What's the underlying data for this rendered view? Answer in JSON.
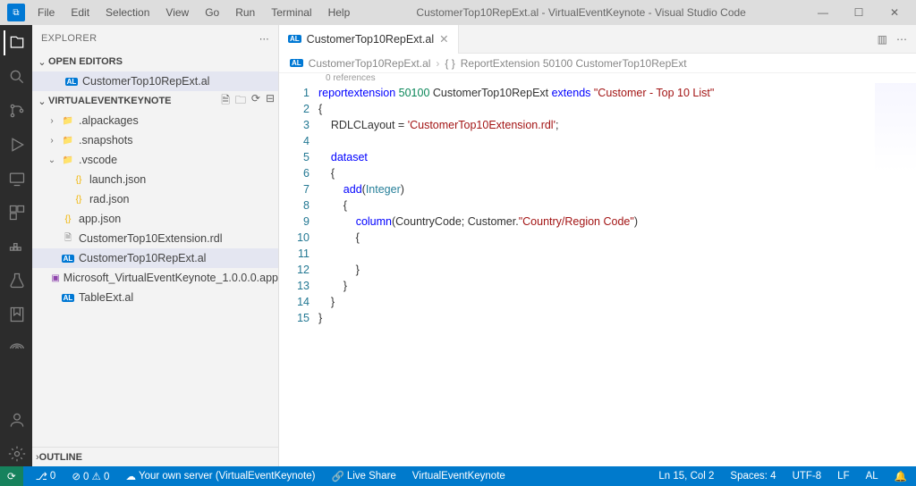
{
  "titlebar": {
    "menu": [
      "File",
      "Edit",
      "Selection",
      "View",
      "Go",
      "Run",
      "Terminal",
      "Help"
    ],
    "title": "CustomerTop10RepExt.al - VirtualEventKeynote - Visual Studio Code",
    "wincontrols": [
      "—",
      "☐",
      "✕"
    ]
  },
  "sidebar": {
    "header": "EXPLORER",
    "openEditors": {
      "label": "OPEN EDITORS",
      "items": [
        {
          "icon": "al",
          "name": "CustomerTop10RepExt.al"
        }
      ]
    },
    "workspace": {
      "label": "VIRTUALEVENTKEYNOTE",
      "tree": [
        {
          "depth": 1,
          "chev": "›",
          "icon": "folder",
          "name": ".alpackages"
        },
        {
          "depth": 1,
          "chev": "›",
          "icon": "folder",
          "name": ".snapshots"
        },
        {
          "depth": 1,
          "chev": "⌄",
          "icon": "folder",
          "name": ".vscode"
        },
        {
          "depth": 2,
          "chev": "",
          "icon": "json",
          "name": "launch.json"
        },
        {
          "depth": 2,
          "chev": "",
          "icon": "json",
          "name": "rad.json"
        },
        {
          "depth": 1,
          "chev": "",
          "icon": "json",
          "name": "app.json"
        },
        {
          "depth": 1,
          "chev": "",
          "icon": "file",
          "name": "CustomerTop10Extension.rdl"
        },
        {
          "depth": 1,
          "chev": "",
          "icon": "al",
          "name": "CustomerTop10RepExt.al",
          "active": true
        },
        {
          "depth": 1,
          "chev": "",
          "icon": "app",
          "name": "Microsoft_VirtualEventKeynote_1.0.0.0.app"
        },
        {
          "depth": 1,
          "chev": "",
          "icon": "al",
          "name": "TableExt.al"
        }
      ]
    },
    "outline": "OUTLINE"
  },
  "editor": {
    "tab": {
      "badge": "AL",
      "name": "CustomerTop10RepExt.al"
    },
    "breadcrumb": {
      "badge": "AL",
      "file": "CustomerTop10RepExt.al",
      "symbolIcon": "{ }",
      "symbol": "ReportExtension 50100 CustomerTop10RepExt"
    },
    "codelens": "0 references",
    "lines": 15,
    "code": [
      [
        [
          "kw",
          "reportextension"
        ],
        [
          "",
          " "
        ],
        [
          "num",
          "50100"
        ],
        [
          "",
          " CustomerTop10RepExt "
        ],
        [
          "kw",
          "extends"
        ],
        [
          "",
          " "
        ],
        [
          "str",
          "\"Customer - Top 10 List\""
        ]
      ],
      [
        [
          "",
          "{"
        ]
      ],
      [
        [
          "",
          "    RDLCLayout = "
        ],
        [
          "str",
          "'CustomerTop10Extension.rdl'"
        ],
        [
          "",
          ";"
        ]
      ],
      [
        [
          "",
          ""
        ]
      ],
      [
        [
          "",
          "    "
        ],
        [
          "kw",
          "dataset"
        ]
      ],
      [
        [
          "",
          "    {"
        ]
      ],
      [
        [
          "",
          "        "
        ],
        [
          "kw",
          "add"
        ],
        [
          "",
          "("
        ],
        [
          "type",
          "Integer"
        ],
        [
          "",
          ")"
        ]
      ],
      [
        [
          "",
          "        {"
        ]
      ],
      [
        [
          "",
          "            "
        ],
        [
          "kw",
          "column"
        ],
        [
          "",
          "(CountryCode; Customer."
        ],
        [
          "str",
          "\"Country/Region Code\""
        ],
        [
          "",
          ")"
        ]
      ],
      [
        [
          "",
          "            {"
        ]
      ],
      [
        [
          "",
          ""
        ]
      ],
      [
        [
          "",
          "            }"
        ]
      ],
      [
        [
          "",
          "        }"
        ]
      ],
      [
        [
          "",
          "    }"
        ]
      ],
      [
        [
          "",
          "}"
        ]
      ]
    ]
  },
  "statusbar": {
    "left": [
      {
        "icon": "⟳",
        "text": ""
      },
      {
        "icon": "⎇",
        "text": "0"
      },
      {
        "icon": "⊘",
        "text": "0  ⚠ 0"
      },
      {
        "icon": "☁",
        "text": "Your own server (VirtualEventKeynote)"
      },
      {
        "icon": "🔗",
        "text": "Live Share"
      },
      {
        "icon": "",
        "text": "VirtualEventKeynote"
      }
    ],
    "right": [
      "Ln 15, Col 2",
      "Spaces: 4",
      "UTF-8",
      "LF",
      "AL",
      "🔔"
    ]
  }
}
